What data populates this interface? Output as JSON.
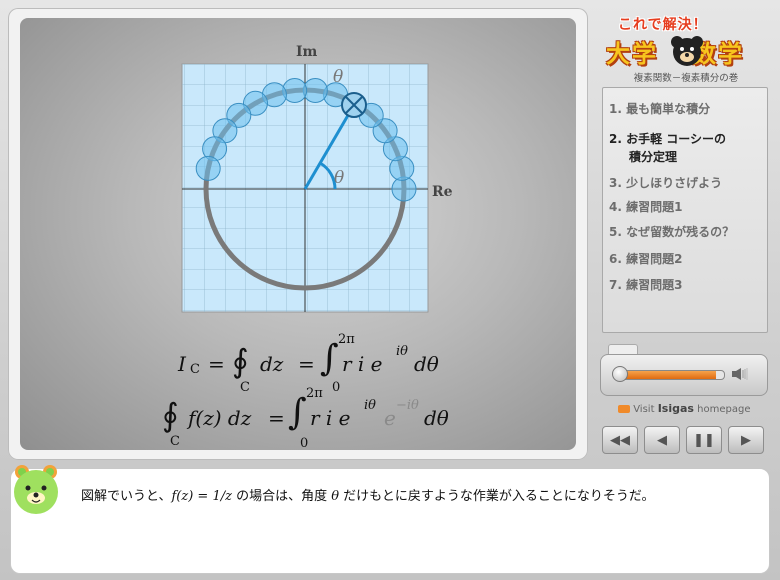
{
  "diagram": {
    "im_label": "Im",
    "re_label": "Re",
    "theta_top": "θ",
    "theta_angle": "θ"
  },
  "equations": {
    "line1": {
      "lhs_I": "I",
      "lhs_sub": "C",
      "eq": "=",
      "oint_sub": "C",
      "dz": "dz",
      "eq2": "=",
      "int_upper": "2π",
      "int_lower": "0",
      "body": "r i e",
      "exp": "iθ",
      "dtheta": "dθ"
    },
    "line2": {
      "oint_sub": "C",
      "fz": "f(z) dz",
      "eq": "=",
      "int_upper": "2π",
      "int_lower": "0",
      "body": "r i e",
      "exp": "iθ",
      "grey": "e",
      "grey_exp": "−iθ",
      "dtheta": "dθ"
    }
  },
  "logo": {
    "top": "これで解決！",
    "main_left": "大学",
    "main_right": "数学"
  },
  "subtitle": "複素関数－複素積分の巻",
  "menu": {
    "items": [
      {
        "num": "1.",
        "label": "最も簡単な積分"
      },
      {
        "num": "2.",
        "label": "お手軽 コーシーの"
      },
      {
        "num": "3.",
        "label": "少しほりさげよう"
      },
      {
        "num": "4.",
        "label": "練習問題1"
      },
      {
        "num": "5.",
        "label": "なぜ留数が残るの？"
      },
      {
        "num": "6.",
        "label": "練習問題2"
      },
      {
        "num": "7.",
        "label": "練習問題3"
      }
    ],
    "item2_line2": "積分定理",
    "active_index": 1
  },
  "player": {
    "progress": 0.93,
    "visit_prefix": "Visit",
    "visit_brand": "Isigas",
    "visit_suffix": "homepage",
    "buttons": {
      "rewind": "◀◀",
      "back": "◀",
      "pause": "❚❚",
      "play": "▶"
    },
    "volume_icon": "speaker-icon"
  },
  "caption": {
    "part1": "図解でいうと、",
    "math": "f(z) = 1/z",
    "part2": " の場合は、角度 ",
    "theta": "θ",
    "part3": " だけもとに戻すような作業が入ることになりそうだ。"
  },
  "colors": {
    "accent_orange": "#e8741a",
    "grid_blue": "#c9e8fb",
    "circle_grey": "#7a7a7a",
    "radius_blue": "#1e8fd0"
  }
}
